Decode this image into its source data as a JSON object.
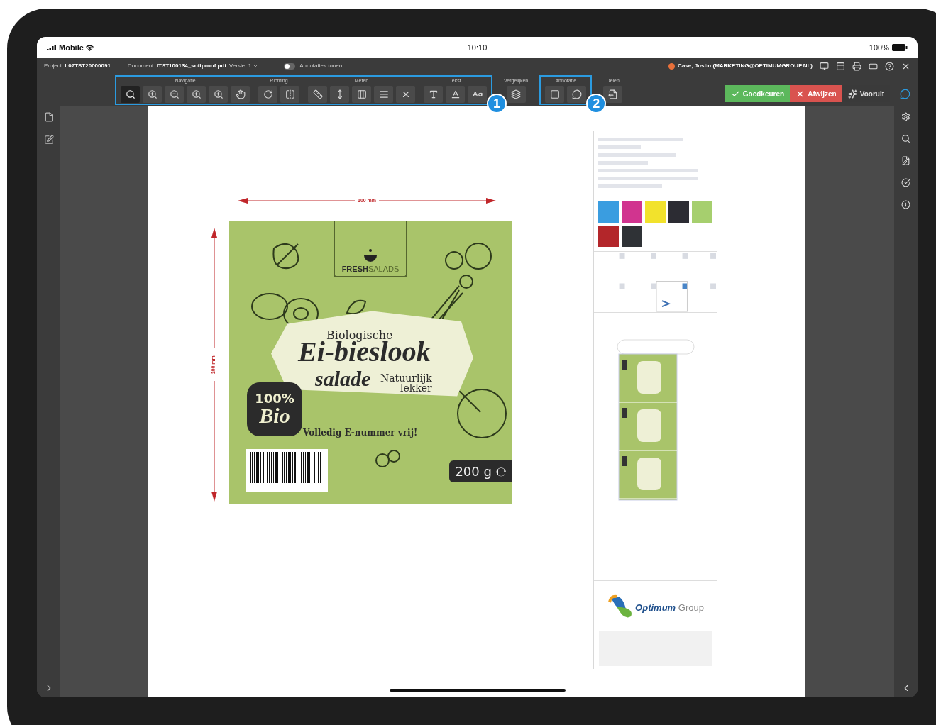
{
  "status_bar": {
    "carrier": "Mobile",
    "time": "10:10",
    "battery": "100%"
  },
  "top_bar": {
    "project_label": "Project:",
    "project": "L07TST20000091",
    "document_label": "Document:",
    "document": "ITST100134_softproof.pdf",
    "version": "Versie: 1",
    "annotations_toggle": {
      "label": "Annotaties tonen",
      "on": false
    },
    "user": "Case, Justin (MARKETING@OPTIMUMGROUP.NL)"
  },
  "toolbar": {
    "sections": [
      {
        "callout": "1",
        "groups": [
          {
            "kind": "navigation",
            "label": "Navigatie",
            "tools": [
              {
                "selected": true
              },
              {
                "selected": false
              },
              {
                "selected": false
              },
              {
                "selected": false
              },
              {
                "selected": false
              },
              {
                "selected": false
              }
            ]
          },
          {
            "kind": "direction",
            "label": "Richting",
            "tools": [
              {
                "selected": false
              },
              {
                "selected": false
              }
            ]
          },
          {
            "kind": "measure",
            "label": "Meten",
            "tools": [
              {
                "selected": false
              },
              {
                "selected": false
              },
              {
                "selected": false
              },
              {
                "selected": false
              },
              {
                "selected": false
              }
            ]
          },
          {
            "kind": "text",
            "label": "Tekst",
            "tools": [
              {
                "selected": false
              },
              {
                "selected": false
              },
              {
                "selected": false
              }
            ]
          }
        ]
      },
      {
        "groups": [
          {
            "kind": "compare",
            "label": "Vergelijken",
            "tools": [
              {
                "selected": false
              }
            ]
          }
        ]
      },
      {
        "callout": "2",
        "groups": [
          {
            "kind": "annotation",
            "label": "Annotatie",
            "tools": [
              {
                "selected": false
              },
              {
                "selected": false
              }
            ]
          }
        ]
      },
      {
        "groups": [
          {
            "kind": "share",
            "label": "Delen",
            "tools": [
              {
                "selected": false
              }
            ]
          }
        ]
      }
    ],
    "actions": [
      {
        "kind": "approve",
        "label": "Goedkeuren"
      },
      {
        "kind": "reject",
        "label": "Afwijzen"
      },
      {
        "kind": "neutral",
        "label": "Voorult"
      }
    ]
  },
  "artwork": {
    "width_dimension": "100 mm",
    "height_dimension": "100 mm",
    "brand": [
      "FRESH",
      "SALADS"
    ],
    "subtitle": "Biologische",
    "title": "Ei-bieslook",
    "title_2": "salade",
    "tagline": [
      "Natuurlijk",
      "lekker"
    ],
    "bio_badge": [
      "100%",
      "Bio"
    ],
    "claim": "Volledig E-nummer vrij!",
    "weight": "200 g ℮"
  },
  "info_panel": {
    "swatches": [
      {
        "color": "#3a9de0"
      },
      {
        "color": "#d1348f"
      },
      {
        "color": "#f2e22c"
      },
      {
        "color": "#2c2c33"
      },
      {
        "color": "#a6cf6e"
      },
      {
        "color": "#b3262a"
      },
      {
        "color": "#2f3236"
      }
    ],
    "logo": [
      "Optimum",
      "Group"
    ]
  }
}
